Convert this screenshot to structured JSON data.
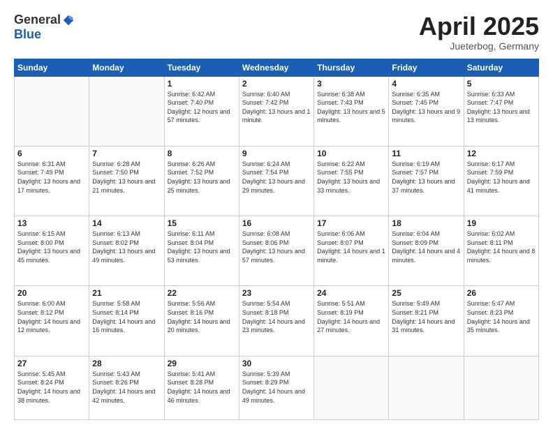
{
  "logo": {
    "general": "General",
    "blue": "Blue"
  },
  "header": {
    "title": "April 2025",
    "subtitle": "Jueterbog, Germany"
  },
  "weekdays": [
    "Sunday",
    "Monday",
    "Tuesday",
    "Wednesday",
    "Thursday",
    "Friday",
    "Saturday"
  ],
  "weeks": [
    [
      {
        "day": "",
        "content": ""
      },
      {
        "day": "",
        "content": ""
      },
      {
        "day": "1",
        "content": "Sunrise: 6:42 AM\nSunset: 7:40 PM\nDaylight: 12 hours and 57 minutes."
      },
      {
        "day": "2",
        "content": "Sunrise: 6:40 AM\nSunset: 7:42 PM\nDaylight: 13 hours and 1 minute."
      },
      {
        "day": "3",
        "content": "Sunrise: 6:38 AM\nSunset: 7:43 PM\nDaylight: 13 hours and 5 minutes."
      },
      {
        "day": "4",
        "content": "Sunrise: 6:35 AM\nSunset: 7:45 PM\nDaylight: 13 hours and 9 minutes."
      },
      {
        "day": "5",
        "content": "Sunrise: 6:33 AM\nSunset: 7:47 PM\nDaylight: 13 hours and 13 minutes."
      }
    ],
    [
      {
        "day": "6",
        "content": "Sunrise: 6:31 AM\nSunset: 7:49 PM\nDaylight: 13 hours and 17 minutes."
      },
      {
        "day": "7",
        "content": "Sunrise: 6:28 AM\nSunset: 7:50 PM\nDaylight: 13 hours and 21 minutes."
      },
      {
        "day": "8",
        "content": "Sunrise: 6:26 AM\nSunset: 7:52 PM\nDaylight: 13 hours and 25 minutes."
      },
      {
        "day": "9",
        "content": "Sunrise: 6:24 AM\nSunset: 7:54 PM\nDaylight: 13 hours and 29 minutes."
      },
      {
        "day": "10",
        "content": "Sunrise: 6:22 AM\nSunset: 7:55 PM\nDaylight: 13 hours and 33 minutes."
      },
      {
        "day": "11",
        "content": "Sunrise: 6:19 AM\nSunset: 7:57 PM\nDaylight: 13 hours and 37 minutes."
      },
      {
        "day": "12",
        "content": "Sunrise: 6:17 AM\nSunset: 7:59 PM\nDaylight: 13 hours and 41 minutes."
      }
    ],
    [
      {
        "day": "13",
        "content": "Sunrise: 6:15 AM\nSunset: 8:00 PM\nDaylight: 13 hours and 45 minutes."
      },
      {
        "day": "14",
        "content": "Sunrise: 6:13 AM\nSunset: 8:02 PM\nDaylight: 13 hours and 49 minutes."
      },
      {
        "day": "15",
        "content": "Sunrise: 6:11 AM\nSunset: 8:04 PM\nDaylight: 13 hours and 53 minutes."
      },
      {
        "day": "16",
        "content": "Sunrise: 6:08 AM\nSunset: 8:06 PM\nDaylight: 13 hours and 57 minutes."
      },
      {
        "day": "17",
        "content": "Sunrise: 6:06 AM\nSunset: 8:07 PM\nDaylight: 14 hours and 1 minute."
      },
      {
        "day": "18",
        "content": "Sunrise: 6:04 AM\nSunset: 8:09 PM\nDaylight: 14 hours and 4 minutes."
      },
      {
        "day": "19",
        "content": "Sunrise: 6:02 AM\nSunset: 8:11 PM\nDaylight: 14 hours and 8 minutes."
      }
    ],
    [
      {
        "day": "20",
        "content": "Sunrise: 6:00 AM\nSunset: 8:12 PM\nDaylight: 14 hours and 12 minutes."
      },
      {
        "day": "21",
        "content": "Sunrise: 5:58 AM\nSunset: 8:14 PM\nDaylight: 14 hours and 16 minutes."
      },
      {
        "day": "22",
        "content": "Sunrise: 5:56 AM\nSunset: 8:16 PM\nDaylight: 14 hours and 20 minutes."
      },
      {
        "day": "23",
        "content": "Sunrise: 5:54 AM\nSunset: 8:18 PM\nDaylight: 14 hours and 23 minutes."
      },
      {
        "day": "24",
        "content": "Sunrise: 5:51 AM\nSunset: 8:19 PM\nDaylight: 14 hours and 27 minutes."
      },
      {
        "day": "25",
        "content": "Sunrise: 5:49 AM\nSunset: 8:21 PM\nDaylight: 14 hours and 31 minutes."
      },
      {
        "day": "26",
        "content": "Sunrise: 5:47 AM\nSunset: 8:23 PM\nDaylight: 14 hours and 35 minutes."
      }
    ],
    [
      {
        "day": "27",
        "content": "Sunrise: 5:45 AM\nSunset: 8:24 PM\nDaylight: 14 hours and 38 minutes."
      },
      {
        "day": "28",
        "content": "Sunrise: 5:43 AM\nSunset: 8:26 PM\nDaylight: 14 hours and 42 minutes."
      },
      {
        "day": "29",
        "content": "Sunrise: 5:41 AM\nSunset: 8:28 PM\nDaylight: 14 hours and 46 minutes."
      },
      {
        "day": "30",
        "content": "Sunrise: 5:39 AM\nSunset: 8:29 PM\nDaylight: 14 hours and 49 minutes."
      },
      {
        "day": "",
        "content": ""
      },
      {
        "day": "",
        "content": ""
      },
      {
        "day": "",
        "content": ""
      }
    ]
  ]
}
